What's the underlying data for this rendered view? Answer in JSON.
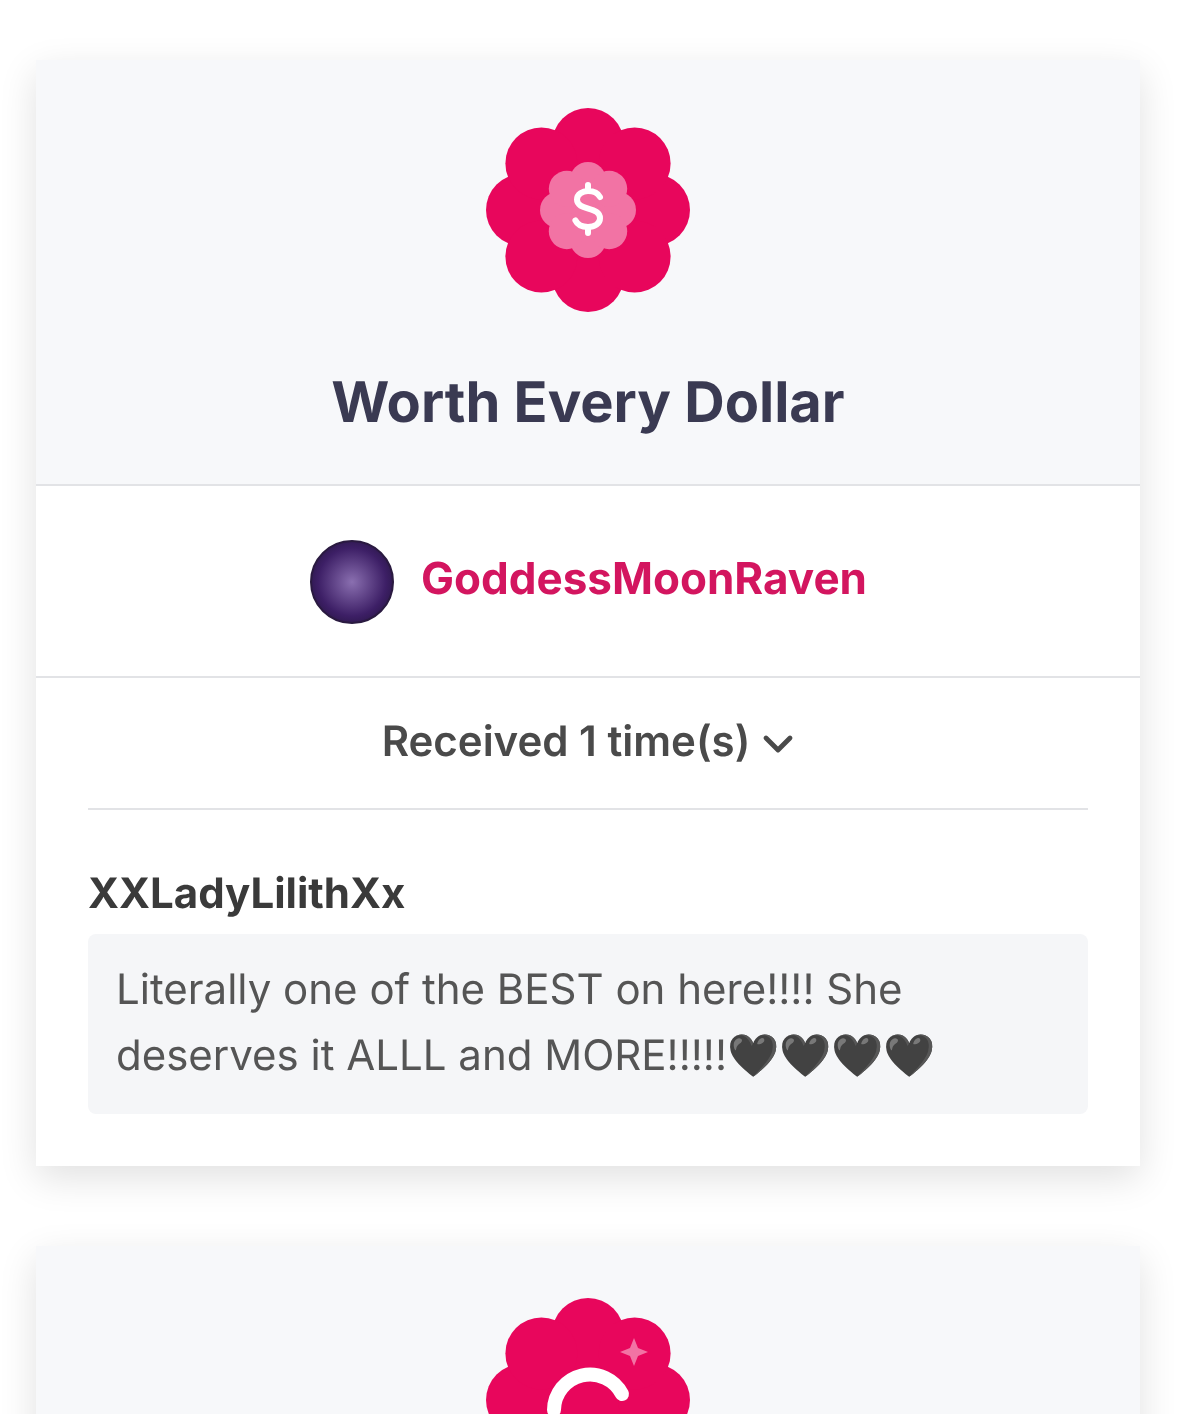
{
  "award": {
    "title": "Worth Every Dollar",
    "recipient": {
      "name": "GoddessMoonRaven"
    },
    "received": {
      "label": "Received 1 time(s)",
      "expanded": true
    },
    "messages": [
      {
        "sender": "XXLadyLilithXx",
        "text": "Literally one of the BEST on here!!!! She deserves it ALLL and MORE!!!!!🖤🖤🖤🖤"
      }
    ]
  }
}
